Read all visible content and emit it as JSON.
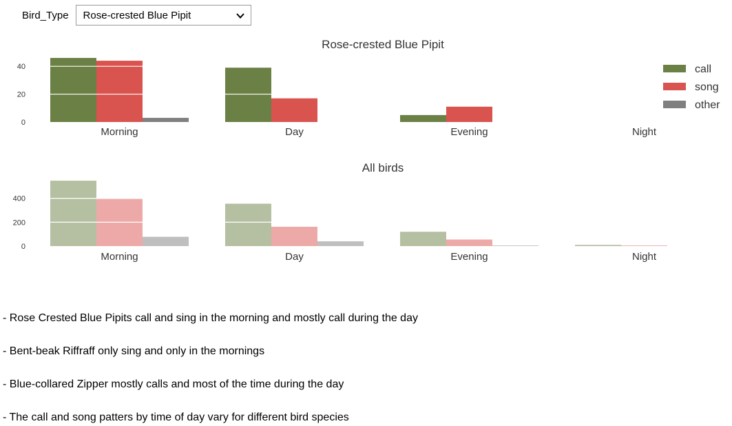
{
  "selector": {
    "label": "Bird_Type",
    "value": "Rose-crested Blue Pipit"
  },
  "colors": {
    "call": "#6b8045",
    "song": "#d9534f",
    "other": "#808080"
  },
  "chart_data": [
    {
      "type": "bar",
      "title": "Rose-crested Blue Pipit",
      "categories": [
        "Morning",
        "Day",
        "Evening",
        "Night"
      ],
      "series": [
        {
          "name": "call",
          "values": [
            46,
            39,
            5,
            0
          ]
        },
        {
          "name": "song",
          "values": [
            44,
            17,
            11,
            0
          ]
        },
        {
          "name": "other",
          "values": [
            3,
            0,
            0,
            0
          ]
        }
      ],
      "yticks": [
        0,
        20,
        40
      ],
      "ylim": [
        0,
        48
      ],
      "grid": true,
      "legend": "right"
    },
    {
      "type": "bar",
      "title": "All birds",
      "categories": [
        "Morning",
        "Day",
        "Evening",
        "Night"
      ],
      "series": [
        {
          "name": "call",
          "values": [
            548,
            355,
            120,
            10
          ]
        },
        {
          "name": "song",
          "values": [
            395,
            162,
            55,
            5
          ]
        },
        {
          "name": "other",
          "values": [
            78,
            40,
            5,
            0
          ]
        }
      ],
      "yticks": [
        0,
        200,
        400
      ],
      "ylim": [
        0,
        560
      ],
      "grid": true,
      "faded": true
    }
  ],
  "notes": [
    "- Rose Crested Blue Pipits call and sing in the morning and mostly call during the day",
    "- Bent-beak Riffraff only sing and only in the mornings",
    "- Blue-collared Zipper mostly calls and most of the time during the day",
    "- The call and song patters by time of day vary for different bird species"
  ]
}
